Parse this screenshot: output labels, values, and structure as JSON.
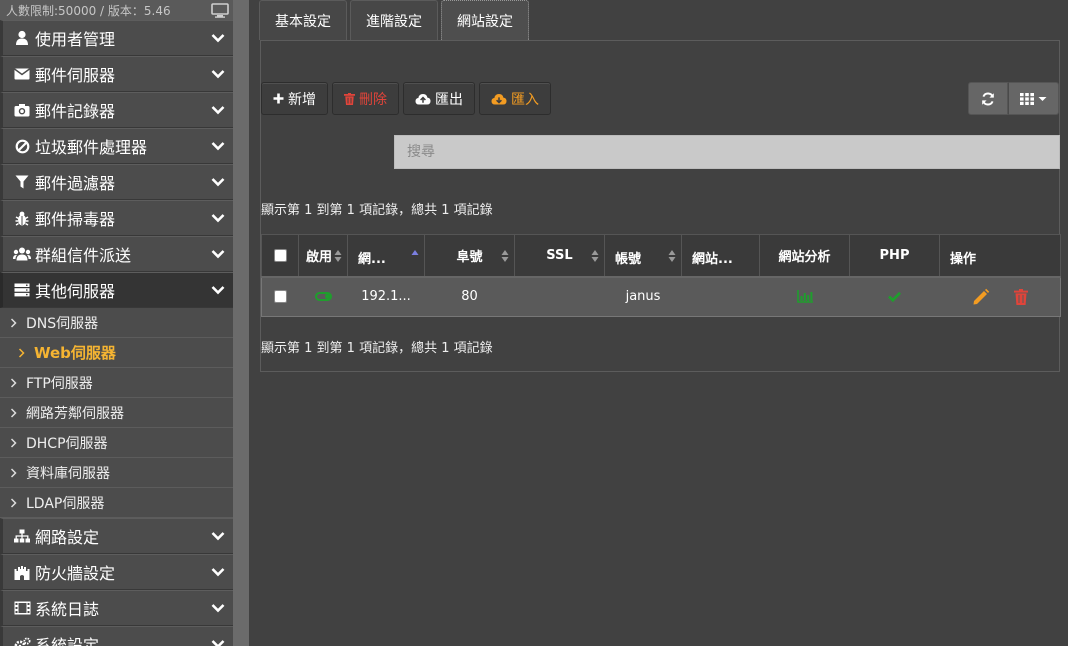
{
  "sidebar": {
    "limit_text": "人數限制:50000 / 版本：5.46",
    "items": [
      {
        "label": "使用者管理",
        "icon": "user-icon"
      },
      {
        "label": "郵件伺服器",
        "icon": "envelope-icon"
      },
      {
        "label": "郵件記錄器",
        "icon": "camera-icon"
      },
      {
        "label": "垃圾郵件處理器",
        "icon": "ban-icon"
      },
      {
        "label": "郵件過濾器",
        "icon": "filter-icon"
      },
      {
        "label": "郵件掃毒器",
        "icon": "bug-icon"
      },
      {
        "label": "群組信件派送",
        "icon": "users-icon"
      },
      {
        "label": "其他伺服器",
        "icon": "server-icon"
      }
    ],
    "sub_items": [
      {
        "label": "DNS伺服器"
      },
      {
        "label": "Web伺服器"
      },
      {
        "label": "FTP伺服器"
      },
      {
        "label": "網路芳鄰伺服器"
      },
      {
        "label": "DHCP伺服器"
      },
      {
        "label": "資料庫伺服器"
      },
      {
        "label": "LDAP伺服器"
      }
    ],
    "bottom_items": [
      {
        "label": "網路設定",
        "icon": "sitemap-icon"
      },
      {
        "label": "防火牆設定",
        "icon": "fort-icon"
      },
      {
        "label": "系統日誌",
        "icon": "film-icon"
      },
      {
        "label": "系統設定",
        "icon": "cogs-icon"
      }
    ]
  },
  "tabs": [
    {
      "label": "基本設定"
    },
    {
      "label": "進階設定"
    },
    {
      "label": "網站設定"
    }
  ],
  "toolbar": {
    "add_label": "新增",
    "delete_label": "刪除",
    "export_label": "匯出",
    "import_label": "匯入"
  },
  "search": {
    "placeholder": "搜尋"
  },
  "info_text": "顯示第 1 到第 1 項記錄，總共 1 項記錄",
  "table": {
    "headers": {
      "enable": "啟用",
      "site": "網...",
      "port": "阜號",
      "ssl": "SSL",
      "account": "帳號",
      "website": "網站...",
      "analytics": "網站分析",
      "php": "PHP",
      "actions": "操作"
    },
    "rows": [
      {
        "site": "192.1...",
        "port": "80",
        "ssl": "",
        "account": "janus",
        "website": ""
      }
    ]
  },
  "colors": {
    "accent_orange": "#f5b432",
    "danger_red": "#e0443a",
    "success_green": "#1f9e2d",
    "sidebar_bg": "#4c4c4c",
    "main_bg": "#414141"
  }
}
